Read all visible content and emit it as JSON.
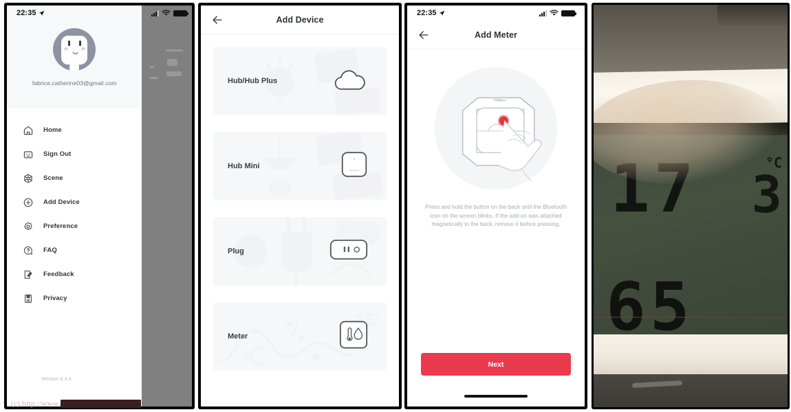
{
  "panel1": {
    "name": "app-drawer-screen",
    "status_bar": {
      "time": "22:35",
      "location_icon": "location-arrow-icon",
      "wifi_icon": "wifi-icon",
      "signal_icon": "cellular-signal-icon",
      "battery_icon": "battery-full-icon"
    },
    "account": {
      "avatar_icon": "robot-avatar-icon",
      "email": "fabrice.catherine03@gmail.com"
    },
    "menu": [
      {
        "icon": "home-icon",
        "label": "Home"
      },
      {
        "icon": "sign-out-icon",
        "label": "Sign Out"
      },
      {
        "icon": "scene-icon",
        "label": "Scene"
      },
      {
        "icon": "plus-circle-icon",
        "label": "Add Device"
      },
      {
        "icon": "gear-icon",
        "label": "Preference"
      },
      {
        "icon": "question-circle-icon",
        "label": "FAQ"
      },
      {
        "icon": "feedback-icon",
        "label": "Feedback"
      },
      {
        "icon": "privacy-lock-icon",
        "label": "Privacy"
      }
    ],
    "version": "Version 3.3.4",
    "watermark": {
      "prefix": "(c) http://www.",
      "redacted": "██████████████"
    }
  },
  "panel2": {
    "name": "add-device-screen",
    "back_icon": "back-arrow-icon",
    "title": "Add Device",
    "devices": [
      {
        "label": "Hub/Hub Plus",
        "art_icon": "cloud-icon"
      },
      {
        "label": "Hub Mini",
        "art_icon": "hub-mini-square-icon"
      },
      {
        "label": "Plug",
        "art_icon": "plug-outlet-icon"
      },
      {
        "label": "Meter",
        "art_icon": "thermometer-humidity-icon"
      }
    ]
  },
  "panel3": {
    "name": "add-meter-screen",
    "status_bar": {
      "time": "22:35",
      "location_icon": "location-arrow-icon",
      "wifi_icon": "wifi-icon",
      "signal_icon": "cellular-signal-icon",
      "battery_icon": "battery-full-icon"
    },
    "back_icon": "back-arrow-icon",
    "title": "Add Meter",
    "illustration_icon": "press-and-hold-button-illustration",
    "instructions": "Press and hold the button on the back until the Bluetooth icon on the screen blinks.  If the add-on was attached magnetically to the back, remove it before pressing.",
    "next_label": "Next"
  },
  "panel4": {
    "name": "meter-photo",
    "lcd": {
      "temperature": "17.3",
      "temperature_whole": "17",
      "temperature_decimal": "3",
      "temperature_unit": "°C",
      "humidity": "65",
      "humidity_unit": "%"
    }
  },
  "colors": {
    "accent_red": "#ea3a4e",
    "card_bg": "#f6f7f9",
    "drawer_head_bg": "#f7f8f9",
    "text_primary": "#32353c",
    "text_muted": "#a7aaae",
    "scrim": "#808080"
  }
}
